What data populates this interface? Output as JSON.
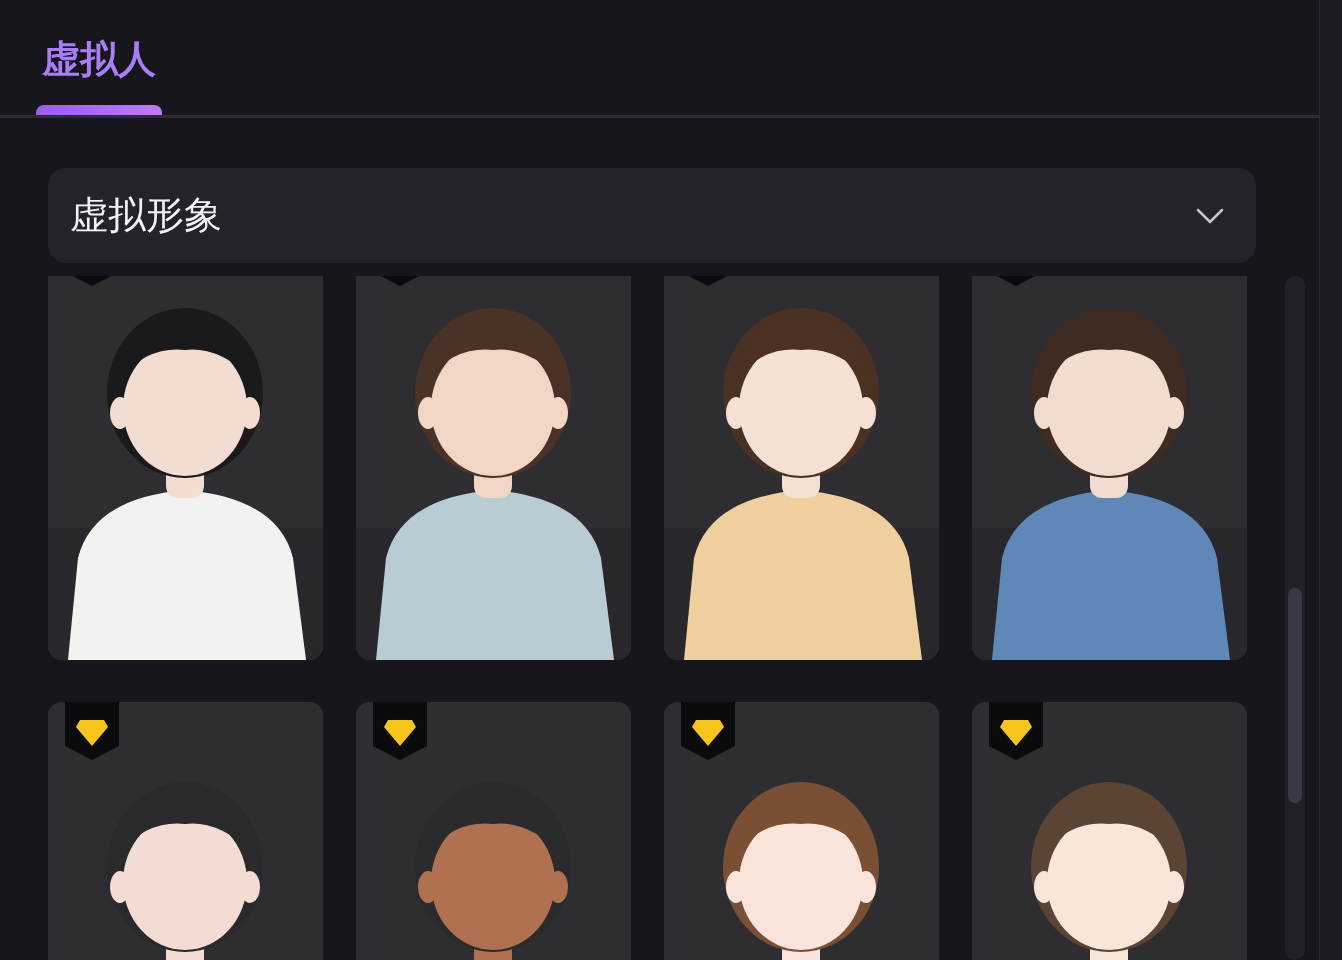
{
  "tab": {
    "label": "虚拟人",
    "selected": true
  },
  "dropdown": {
    "value": "虚拟形象"
  },
  "avatars": [
    {
      "kind": "picture",
      "premium": true
    },
    {
      "kind": "picture",
      "premium": true
    },
    {
      "kind": "picture",
      "premium": true
    },
    {
      "kind": "picture",
      "premium": true
    },
    {
      "kind": "picture",
      "premium": true
    },
    {
      "kind": "picture",
      "premium": true
    },
    {
      "kind": "picture",
      "premium": true
    },
    {
      "kind": "picture",
      "premium": true
    }
  ]
}
